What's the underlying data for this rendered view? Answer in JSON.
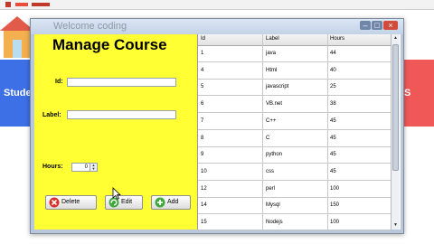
{
  "background": {
    "left_band_label": "Stude",
    "right_band_label": "S",
    "colors": {
      "left_band": "#3d6fe6",
      "right_band": "#f05757",
      "panel": "#ffff33"
    }
  },
  "window": {
    "title_text": "Welcome coding",
    "buttons": {
      "minimize": "–",
      "maximize": "□",
      "close": "×"
    }
  },
  "form": {
    "title": "Manage Course",
    "id_label": "Id:",
    "label_label": "Label:",
    "hours_label": "Hours:",
    "id_value": "",
    "label_value": "",
    "hours_value": "0",
    "spin_up": "▲",
    "spin_down": "▼",
    "buttons": {
      "delete": {
        "label": "Delete",
        "icon": "delete-icon"
      },
      "edit": {
        "label": "Edit",
        "icon": "refresh-icon"
      },
      "add": {
        "label": "Add",
        "icon": "plus-icon"
      }
    }
  },
  "table": {
    "columns": [
      "Id",
      "Label",
      "Hours"
    ],
    "rows": [
      [
        "1",
        "java",
        "44"
      ],
      [
        "4",
        "Html",
        "40"
      ],
      [
        "5",
        "javascript",
        "25"
      ],
      [
        "6",
        "VB.net",
        "38"
      ],
      [
        "7",
        "C++",
        "45"
      ],
      [
        "8",
        "C",
        "45"
      ],
      [
        "9",
        "python",
        "45"
      ],
      [
        "10",
        "css",
        "45"
      ],
      [
        "12",
        "perl",
        "100"
      ],
      [
        "14",
        "Mysql",
        "150"
      ],
      [
        "15",
        "Nodejs",
        "100"
      ]
    ],
    "scroll_up": "▲",
    "scroll_down": "▼"
  }
}
